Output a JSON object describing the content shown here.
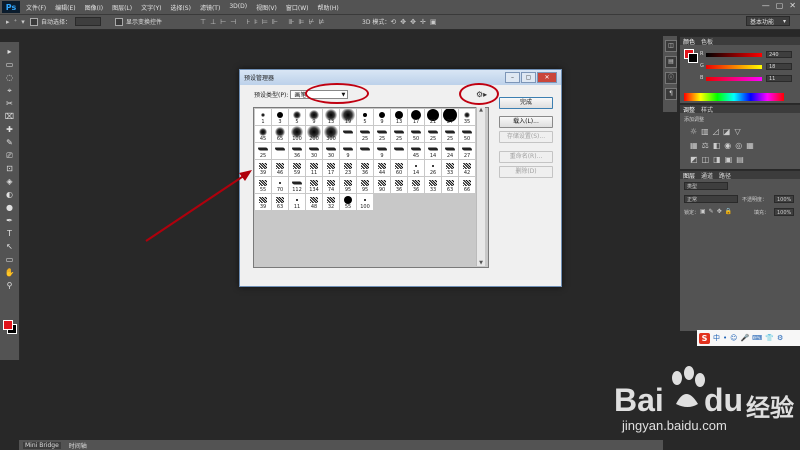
{
  "app": {
    "logo": "Ps",
    "menus": [
      "文件(F)",
      "编辑(E)",
      "图像(I)",
      "图层(L)",
      "文字(Y)",
      "选择(S)",
      "滤镜(T)",
      "3D(D)",
      "视图(V)",
      "窗口(W)",
      "帮助(H)"
    ],
    "window_controls": [
      "—",
      "▢",
      "✕"
    ]
  },
  "options_bar": {
    "auto_select_label": "自动选择：",
    "show_transform_label": "显示变换控件",
    "mode_3d_label": "3D 模式：",
    "workspace": "基本功能"
  },
  "tools": [
    "▸",
    "▭",
    "◌",
    "⌖",
    "✂",
    "⌧",
    "✚",
    "✎",
    "⎚",
    "⊡",
    "◈",
    "◐",
    "●",
    "✒",
    "T",
    "↖",
    "▭",
    "✋",
    "⚲"
  ],
  "panels": {
    "color": {
      "tabs": [
        "颜色",
        "色板"
      ],
      "labels": [
        "R",
        "G",
        "B"
      ],
      "values": [
        "240",
        "18",
        "11"
      ]
    },
    "adjustments": {
      "tabs": [
        "调整",
        "样式"
      ],
      "hint": "添加调整"
    },
    "layers": {
      "tabs": [
        "图层",
        "通道",
        "路径"
      ],
      "kind_label": "类型",
      "blend_mode": "正常",
      "opacity_label": "不透明度：",
      "opacity_value": "100%",
      "lock_label": "锁定：",
      "fill_label": "填充：",
      "fill_value": "100%"
    }
  },
  "bottom_tabs": [
    "Mini Bridge",
    "时间轴"
  ],
  "dialog": {
    "title": "预设管理器",
    "preset_type_label": "预设类型(P):",
    "preset_type_value": "画笔",
    "buttons": {
      "done": "完成",
      "load": "载入(L)...",
      "save": "存储设置(S)...",
      "rename": "重命名(R)...",
      "delete": "删除(D)"
    },
    "brushes": [
      {
        "n": "1",
        "s": "soft",
        "z": 2
      },
      {
        "n": "3",
        "s": "hard",
        "z": 3
      },
      {
        "n": "5",
        "s": "soft",
        "z": 4
      },
      {
        "n": "9",
        "s": "soft",
        "z": 5
      },
      {
        "n": "13",
        "s": "soft",
        "z": 6
      },
      {
        "n": "19",
        "s": "soft",
        "z": 7
      },
      {
        "n": "5",
        "s": "hard",
        "z": 2
      },
      {
        "n": "9",
        "s": "hard",
        "z": 3
      },
      {
        "n": "13",
        "s": "hard",
        "z": 4
      },
      {
        "n": "17",
        "s": "hard",
        "z": 5
      },
      {
        "n": "21",
        "s": "hard",
        "z": 6
      },
      {
        "n": "27",
        "s": "hard",
        "z": 7
      },
      {
        "n": "35",
        "s": "soft",
        "z": 3
      },
      {
        "n": "45",
        "s": "soft",
        "z": 4
      },
      {
        "n": "65",
        "s": "soft",
        "z": 5
      },
      {
        "n": "100",
        "s": "soft",
        "z": 6
      },
      {
        "n": "200",
        "s": "soft",
        "z": 7
      },
      {
        "n": "300",
        "s": "soft",
        "z": 7
      },
      {
        "n": "",
        "s": "stroke",
        "z": 3
      },
      {
        "n": "25",
        "s": "stroke",
        "z": 3
      },
      {
        "n": "25",
        "s": "stroke",
        "z": 3
      },
      {
        "n": "25",
        "s": "stroke",
        "z": 3
      },
      {
        "n": "50",
        "s": "stroke",
        "z": 3
      },
      {
        "n": "25",
        "s": "stroke",
        "z": 3
      },
      {
        "n": "25",
        "s": "stroke",
        "z": 3
      },
      {
        "n": "50",
        "s": "stroke",
        "z": 3
      },
      {
        "n": "25",
        "s": "stroke",
        "z": 3
      },
      {
        "n": "",
        "s": "stroke",
        "z": 3
      },
      {
        "n": "36",
        "s": "stroke",
        "z": 3
      },
      {
        "n": "30",
        "s": "stroke",
        "z": 3
      },
      {
        "n": "30",
        "s": "stroke",
        "z": 3
      },
      {
        "n": "9",
        "s": "stroke",
        "z": 3
      },
      {
        "n": "",
        "s": "stroke",
        "z": 3
      },
      {
        "n": "9",
        "s": "stroke",
        "z": 3
      },
      {
        "n": "",
        "s": "stroke",
        "z": 3
      },
      {
        "n": "45",
        "s": "stroke",
        "z": 3
      },
      {
        "n": "14",
        "s": "stroke",
        "z": 3
      },
      {
        "n": "24",
        "s": "stroke",
        "z": 3
      },
      {
        "n": "27",
        "s": "stroke",
        "z": 3
      },
      {
        "n": "39",
        "s": "splat",
        "z": 3
      },
      {
        "n": "46",
        "s": "splat",
        "z": 3
      },
      {
        "n": "59",
        "s": "splat",
        "z": 3
      },
      {
        "n": "11",
        "s": "splat",
        "z": 3
      },
      {
        "n": "17",
        "s": "splat",
        "z": 3
      },
      {
        "n": "23",
        "s": "splat",
        "z": 3
      },
      {
        "n": "36",
        "s": "splat",
        "z": 3
      },
      {
        "n": "44",
        "s": "splat",
        "z": 3
      },
      {
        "n": "60",
        "s": "splat",
        "z": 3
      },
      {
        "n": "14",
        "s": "dot",
        "z": 1
      },
      {
        "n": "26",
        "s": "dot",
        "z": 1
      },
      {
        "n": "33",
        "s": "splat",
        "z": 3
      },
      {
        "n": "42",
        "s": "splat",
        "z": 3
      },
      {
        "n": "55",
        "s": "splat",
        "z": 3
      },
      {
        "n": "70",
        "s": "dot",
        "z": 1
      },
      {
        "n": "112",
        "s": "stroke",
        "z": 3
      },
      {
        "n": "134",
        "s": "splat",
        "z": 3
      },
      {
        "n": "74",
        "s": "splat",
        "z": 3
      },
      {
        "n": "95",
        "s": "splat",
        "z": 3
      },
      {
        "n": "95",
        "s": "splat",
        "z": 3
      },
      {
        "n": "90",
        "s": "splat",
        "z": 3
      },
      {
        "n": "36",
        "s": "splat",
        "z": 3
      },
      {
        "n": "36",
        "s": "splat",
        "z": 3
      },
      {
        "n": "33",
        "s": "splat",
        "z": 3
      },
      {
        "n": "63",
        "s": "splat",
        "z": 3
      },
      {
        "n": "66",
        "s": "splat",
        "z": 3
      },
      {
        "n": "39",
        "s": "splat",
        "z": 3
      },
      {
        "n": "63",
        "s": "splat",
        "z": 3
      },
      {
        "n": "11",
        "s": "dot",
        "z": 1
      },
      {
        "n": "48",
        "s": "splat",
        "z": 3
      },
      {
        "n": "32",
        "s": "splat",
        "z": 3
      },
      {
        "n": "55",
        "s": "hard",
        "z": 4
      },
      {
        "n": "100",
        "s": "dot",
        "z": 1
      }
    ]
  },
  "watermark": {
    "brand": "Bai",
    "brand_tail": "du",
    "cn": "经验",
    "url": "jingyan.baidu.com"
  },
  "ime": {
    "items": [
      "中",
      "•",
      "☺",
      "🎤",
      "⌨",
      "👕",
      "⚙"
    ]
  }
}
